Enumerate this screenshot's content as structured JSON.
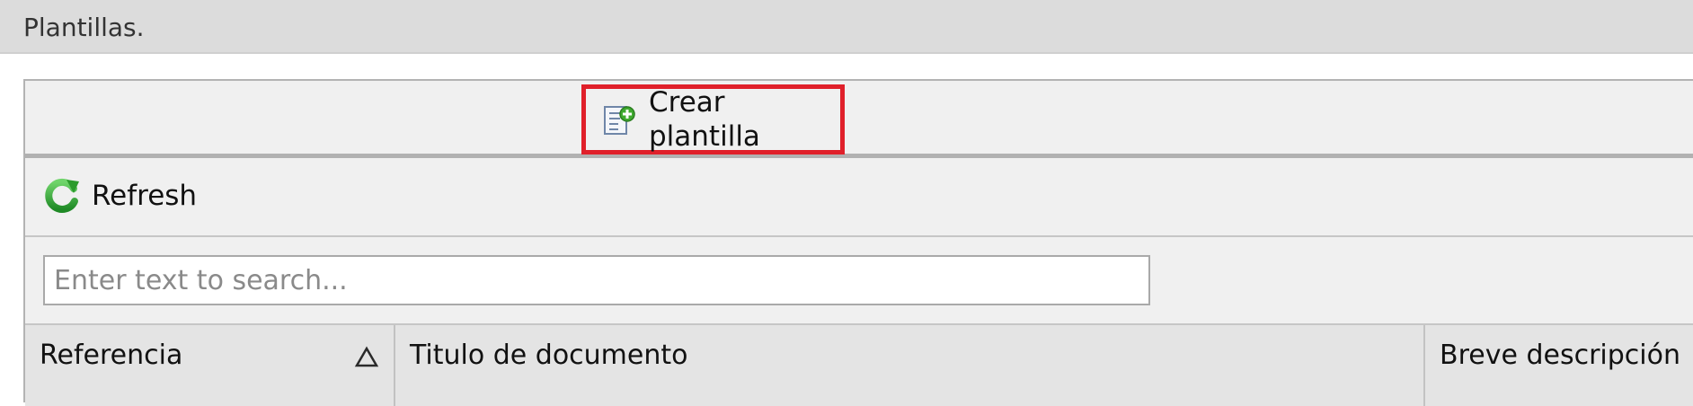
{
  "header": {
    "title": "Plantillas."
  },
  "toolbar": {
    "create_label": "Crear plantilla",
    "create_icon": "add-document-icon",
    "refresh_label": "Refresh",
    "refresh_icon": "refresh-icon"
  },
  "search": {
    "placeholder": "Enter text to search...",
    "value": ""
  },
  "grid": {
    "columns": [
      {
        "label": "Referencia",
        "sort": "ascending"
      },
      {
        "label": "Titulo de documento"
      },
      {
        "label": "Breve descripción"
      }
    ]
  },
  "colors": {
    "highlight": "#e0202a",
    "header_bg": "#dcdcdc",
    "toolbar_bg": "#f0f0f0",
    "refresh_green": "#2e9e2e"
  }
}
